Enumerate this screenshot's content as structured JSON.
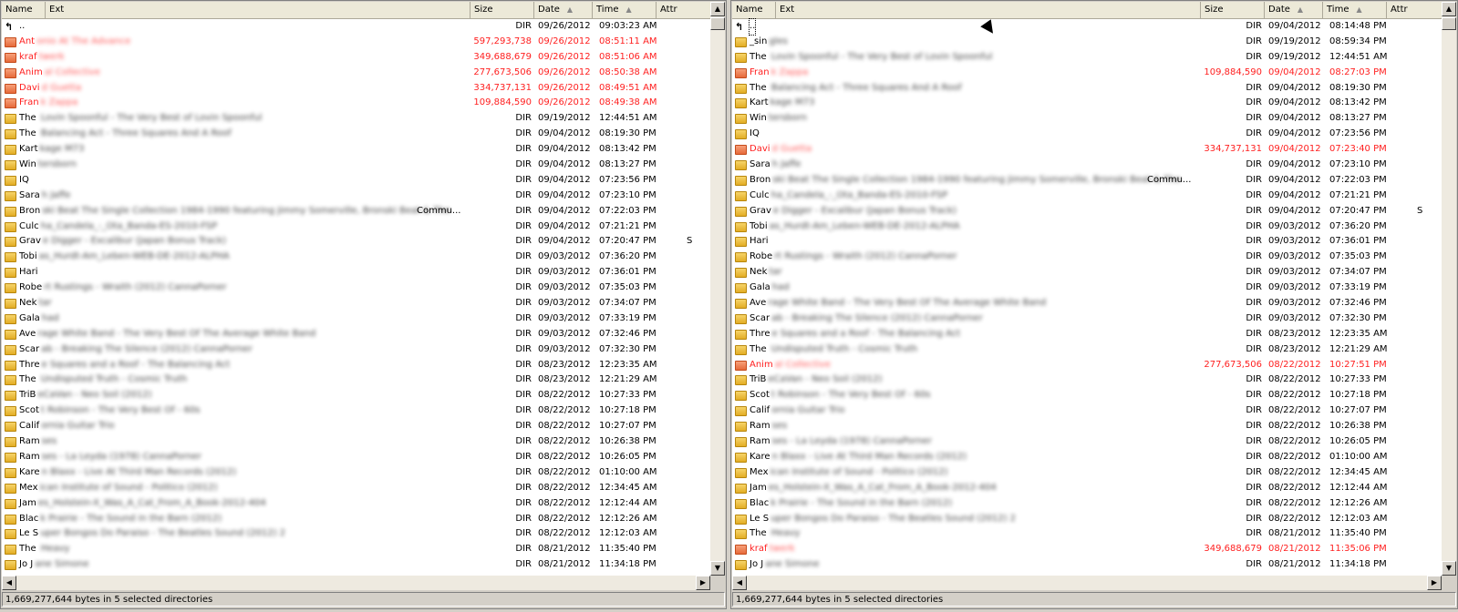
{
  "columns": {
    "name": "Name",
    "ext": "Ext",
    "size": "Size",
    "date": "Date",
    "time": "Time",
    "attr": "Attr"
  },
  "left": {
    "status": "1,669,277,644 bytes in 5 selected directories",
    "rows": [
      {
        "up": true,
        "name": "..",
        "size": "DIR",
        "date": "09/26/2012",
        "time": "09:03:23 AM"
      },
      {
        "name": "Ant",
        "blur": "onio At The Advance",
        "size": "597,293,738",
        "date": "09/26/2012",
        "time": "08:51:11 AM",
        "red": true
      },
      {
        "name": "kraf",
        "blur": "twerk",
        "size": "349,688,679",
        "date": "09/26/2012",
        "time": "08:51:06 AM",
        "red": true
      },
      {
        "name": "Anim",
        "blur": "al Collective",
        "size": "277,673,506",
        "date": "09/26/2012",
        "time": "08:50:38 AM",
        "red": true
      },
      {
        "name": "Davi",
        "blur": "d Guetta",
        "size": "334,737,131",
        "date": "09/26/2012",
        "time": "08:49:51 AM",
        "red": true
      },
      {
        "name": "Fran",
        "blur": "k Zappa",
        "size": "109,884,590",
        "date": "09/26/2012",
        "time": "08:49:38 AM",
        "red": true
      },
      {
        "name": "The",
        "blur": " Lovin Spoonful - The Very Best of Lovin Spoonful",
        "size": "DIR",
        "date": "09/19/2012",
        "time": "12:44:51 AM"
      },
      {
        "name": "The",
        "blur": " Balancing Act - Three Squares And A Roof",
        "size": "DIR",
        "date": "09/04/2012",
        "time": "08:19:30 PM"
      },
      {
        "name": "Kart",
        "blur": "kage M73",
        "size": "DIR",
        "date": "09/04/2012",
        "time": "08:13:42 PM"
      },
      {
        "name": "Win",
        "blur": "tersborn",
        "size": "DIR",
        "date": "09/04/2012",
        "time": "08:13:27 PM"
      },
      {
        "name": "IQ",
        "blur": "",
        "size": "DIR",
        "date": "09/04/2012",
        "time": "07:23:56 PM"
      },
      {
        "name": "Sara",
        "blur": "h Jaffe",
        "size": "DIR",
        "date": "09/04/2012",
        "time": "07:23:10 PM"
      },
      {
        "name": "Bron",
        "blur": "ski Beat The Single Collection 1984-1990 featuring Jimmy Somerville, Bronski Beat & The",
        "ext": "Commu...",
        "size": "DIR",
        "date": "09/04/2012",
        "time": "07:22:03 PM"
      },
      {
        "name": "Culc",
        "blur": "ha_Candela_-_Ota_Banda-ES-2010-FSP",
        "size": "DIR",
        "date": "09/04/2012",
        "time": "07:21:21 PM"
      },
      {
        "name": "Grav",
        "blur": "e Digger - Excalibur (Japan Bonus Track)",
        "size": "DIR",
        "date": "09/04/2012",
        "time": "07:20:47 PM",
        "attr": "S"
      },
      {
        "name": "Tobi",
        "blur": "as_Hurdt-Am_Leben-WEB-DE-2012-ALPHA",
        "size": "DIR",
        "date": "09/03/2012",
        "time": "07:36:20 PM"
      },
      {
        "name": "Hari",
        "blur": "",
        "size": "DIR",
        "date": "09/03/2012",
        "time": "07:36:01 PM"
      },
      {
        "name": "Robe",
        "blur": "rt Rustings - Wraith (2012) CannaPorner",
        "size": "DIR",
        "date": "09/03/2012",
        "time": "07:35:03 PM"
      },
      {
        "name": "Nek",
        "blur": "tar",
        "size": "DIR",
        "date": "09/03/2012",
        "time": "07:34:07 PM"
      },
      {
        "name": "Gala",
        "blur": "had",
        "size": "DIR",
        "date": "09/03/2012",
        "time": "07:33:19 PM"
      },
      {
        "name": "Ave",
        "blur": "rage White Band - The Very Best Of The Average White Band",
        "size": "DIR",
        "date": "09/03/2012",
        "time": "07:32:46 PM"
      },
      {
        "name": "Scar",
        "blur": "ab - Breaking The Silence (2012) CannaPorner",
        "size": "DIR",
        "date": "09/03/2012",
        "time": "07:32:30 PM"
      },
      {
        "name": "Thre",
        "blur": "e Squares and a Roof - The Balancing Act",
        "size": "DIR",
        "date": "08/23/2012",
        "time": "12:23:35 AM"
      },
      {
        "name": "The",
        "blur": " Undisputed Truth - Cosmic Truth",
        "size": "DIR",
        "date": "08/23/2012",
        "time": "12:21:29 AM"
      },
      {
        "name": "TriB",
        "blur": "eCaVan - Neo Soil (2012)",
        "size": "DIR",
        "date": "08/22/2012",
        "time": "10:27:33 PM"
      },
      {
        "name": "Scot",
        "blur": "t Robinson - The Very Best Of - 60s",
        "size": "DIR",
        "date": "08/22/2012",
        "time": "10:27:18 PM"
      },
      {
        "name": "Calif",
        "blur": "ornia Guitar Trio",
        "size": "DIR",
        "date": "08/22/2012",
        "time": "10:27:07 PM"
      },
      {
        "name": "Ram",
        "blur": "ses",
        "size": "DIR",
        "date": "08/22/2012",
        "time": "10:26:38 PM"
      },
      {
        "name": "Ram",
        "blur": "ses - La Leyda (1978) CannaPorner",
        "size": "DIR",
        "date": "08/22/2012",
        "time": "10:26:05 PM"
      },
      {
        "name": "Kare",
        "blur": "n Blaxx - Live At Third Man Records (2012)",
        "size": "DIR",
        "date": "08/22/2012",
        "time": "01:10:00 AM"
      },
      {
        "name": "Mex",
        "blur": "ican Institute of Sound - Politico (2012)",
        "size": "DIR",
        "date": "08/22/2012",
        "time": "12:34:45 AM"
      },
      {
        "name": "Jam",
        "blur": "es_Holstein-X_Was_A_Cat_From_A_Book-2012-404",
        "size": "DIR",
        "date": "08/22/2012",
        "time": "12:12:44 AM"
      },
      {
        "name": "Blac",
        "blur": "k Prairie - The Sound in the Barn (2012)",
        "size": "DIR",
        "date": "08/22/2012",
        "time": "12:12:26 AM"
      },
      {
        "name": "Le S",
        "blur": "uper Bongos Do Paraiso - The Beatles Sound (2012) 2",
        "size": "DIR",
        "date": "08/22/2012",
        "time": "12:12:03 AM"
      },
      {
        "name": "The",
        "blur": " Heavy",
        "size": "DIR",
        "date": "08/21/2012",
        "time": "11:35:40 PM"
      },
      {
        "name": "Jo J",
        "blur": "ane Simone",
        "size": "DIR",
        "date": "08/21/2012",
        "time": "11:34:18 PM"
      }
    ]
  },
  "right": {
    "status": "1,669,277,644 bytes in 5 selected directories",
    "rows": [
      {
        "up": true,
        "name": "..",
        "size": "DIR",
        "date": "09/04/2012",
        "time": "08:14:48 PM",
        "sel": true
      },
      {
        "name": "_sin",
        "blur": "gles",
        "size": "DIR",
        "date": "09/19/2012",
        "time": "08:59:34 PM"
      },
      {
        "name": "The",
        "blur": " Lovin Spoonful - The Very Best of Lovin Spoonful",
        "size": "DIR",
        "date": "09/19/2012",
        "time": "12:44:51 AM"
      },
      {
        "name": "Fran",
        "blur": "k Zappa",
        "size": "109,884,590",
        "date": "09/04/2012",
        "time": "08:27:03 PM",
        "red": true
      },
      {
        "name": "The",
        "blur": " Balancing Act - Three Squares And A Roof",
        "size": "DIR",
        "date": "09/04/2012",
        "time": "08:19:30 PM"
      },
      {
        "name": "Kart",
        "blur": "kage M73",
        "size": "DIR",
        "date": "09/04/2012",
        "time": "08:13:42 PM"
      },
      {
        "name": "Win",
        "blur": "tersborn",
        "size": "DIR",
        "date": "09/04/2012",
        "time": "08:13:27 PM"
      },
      {
        "name": "IQ",
        "blur": "",
        "size": "DIR",
        "date": "09/04/2012",
        "time": "07:23:56 PM"
      },
      {
        "name": "Davi",
        "blur": "d Guetta",
        "size": "334,737,131",
        "date": "09/04/2012",
        "time": "07:23:40 PM",
        "red": true
      },
      {
        "name": "Sara",
        "blur": "h Jaffe",
        "size": "DIR",
        "date": "09/04/2012",
        "time": "07:23:10 PM"
      },
      {
        "name": "Bron",
        "blur": "ski Beat The Single Collection 1984-1990 featuring Jimmy Somerville, Bronski Beat & The",
        "ext": "Commu...",
        "size": "DIR",
        "date": "09/04/2012",
        "time": "07:22:03 PM"
      },
      {
        "name": "Culc",
        "blur": "ha_Candela_-_Ota_Banda-ES-2010-FSP",
        "size": "DIR",
        "date": "09/04/2012",
        "time": "07:21:21 PM"
      },
      {
        "name": "Grav",
        "blur": "e Digger - Excalibur (Japan Bonus Track)",
        "size": "DIR",
        "date": "09/04/2012",
        "time": "07:20:47 PM",
        "attr": "S"
      },
      {
        "name": "Tobi",
        "blur": "as_Hurdt-Am_Leben-WEB-DE-2012-ALPHA",
        "size": "DIR",
        "date": "09/03/2012",
        "time": "07:36:20 PM"
      },
      {
        "name": "Hari",
        "blur": "",
        "size": "DIR",
        "date": "09/03/2012",
        "time": "07:36:01 PM"
      },
      {
        "name": "Robe",
        "blur": "rt Rustings - Wraith (2012) CannaPorner",
        "size": "DIR",
        "date": "09/03/2012",
        "time": "07:35:03 PM"
      },
      {
        "name": "Nek",
        "blur": "tar",
        "size": "DIR",
        "date": "09/03/2012",
        "time": "07:34:07 PM"
      },
      {
        "name": "Gala",
        "blur": "had",
        "size": "DIR",
        "date": "09/03/2012",
        "time": "07:33:19 PM"
      },
      {
        "name": "Ave",
        "blur": "rage White Band - The Very Best Of The Average White Band",
        "size": "DIR",
        "date": "09/03/2012",
        "time": "07:32:46 PM"
      },
      {
        "name": "Scar",
        "blur": "ab - Breaking The Silence (2012) CannaPorner",
        "size": "DIR",
        "date": "09/03/2012",
        "time": "07:32:30 PM"
      },
      {
        "name": "Thre",
        "blur": "e Squares and a Roof - The Balancing Act",
        "size": "DIR",
        "date": "08/23/2012",
        "time": "12:23:35 AM"
      },
      {
        "name": "The",
        "blur": " Undisputed Truth - Cosmic Truth",
        "size": "DIR",
        "date": "08/23/2012",
        "time": "12:21:29 AM"
      },
      {
        "name": "Anim",
        "blur": "al Collective",
        "size": "277,673,506",
        "date": "08/22/2012",
        "time": "10:27:51 PM",
        "red": true
      },
      {
        "name": "TriB",
        "blur": "eCaVan - Neo Soil (2012)",
        "size": "DIR",
        "date": "08/22/2012",
        "time": "10:27:33 PM"
      },
      {
        "name": "Scot",
        "blur": "t Robinson - The Very Best Of - 60s",
        "size": "DIR",
        "date": "08/22/2012",
        "time": "10:27:18 PM"
      },
      {
        "name": "Calif",
        "blur": "ornia Guitar Trio",
        "size": "DIR",
        "date": "08/22/2012",
        "time": "10:27:07 PM"
      },
      {
        "name": "Ram",
        "blur": "ses",
        "size": "DIR",
        "date": "08/22/2012",
        "time": "10:26:38 PM"
      },
      {
        "name": "Ram",
        "blur": "ses - La Leyda (1978) CannaPorner",
        "size": "DIR",
        "date": "08/22/2012",
        "time": "10:26:05 PM"
      },
      {
        "name": "Kare",
        "blur": "n Blaxx - Live At Third Man Records (2012)",
        "size": "DIR",
        "date": "08/22/2012",
        "time": "01:10:00 AM"
      },
      {
        "name": "Mex",
        "blur": "ican Institute of Sound - Politico (2012)",
        "size": "DIR",
        "date": "08/22/2012",
        "time": "12:34:45 AM"
      },
      {
        "name": "Jam",
        "blur": "es_Holstein-X_Was_A_Cat_From_A_Book-2012-404",
        "size": "DIR",
        "date": "08/22/2012",
        "time": "12:12:44 AM"
      },
      {
        "name": "Blac",
        "blur": "k Prairie - The Sound in the Barn (2012)",
        "size": "DIR",
        "date": "08/22/2012",
        "time": "12:12:26 AM"
      },
      {
        "name": "Le S",
        "blur": "uper Bongos Do Paraiso - The Beatles Sound (2012) 2",
        "size": "DIR",
        "date": "08/22/2012",
        "time": "12:12:03 AM"
      },
      {
        "name": "The",
        "blur": " Heavy",
        "size": "DIR",
        "date": "08/21/2012",
        "time": "11:35:40 PM"
      },
      {
        "name": "kraf",
        "blur": "twerk",
        "size": "349,688,679",
        "date": "08/21/2012",
        "time": "11:35:06 PM",
        "red": true
      },
      {
        "name": "Jo J",
        "blur": "ane Simone",
        "size": "DIR",
        "date": "08/21/2012",
        "time": "11:34:18 PM"
      }
    ]
  },
  "icons": {
    "up": "parent-dir-icon",
    "folder": "folder-icon",
    "sort": "sort-arrow-icon",
    "scroll_up": "scroll-up-icon",
    "scroll_down": "scroll-down-icon",
    "scroll_left": "scroll-left-icon",
    "scroll_right": "scroll-right-icon"
  },
  "colors": {
    "highlight_text": "#ff2020",
    "folder": "#e8b52a",
    "background": "#d4d0c8"
  }
}
